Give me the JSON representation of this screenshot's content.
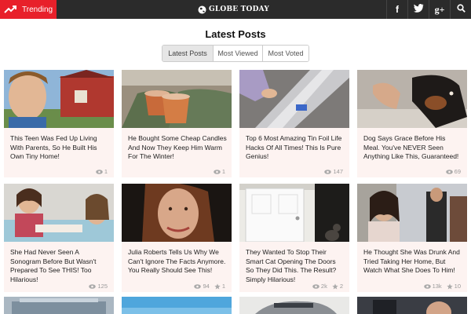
{
  "topbar": {
    "trending_label": "Trending",
    "brand": "GLOBE TODAY",
    "social": [
      {
        "name": "facebook",
        "glyph": "f"
      },
      {
        "name": "twitter",
        "glyph": ""
      },
      {
        "name": "google-plus",
        "glyph": "g+"
      },
      {
        "name": "search",
        "glyph": ""
      }
    ]
  },
  "main": {
    "title": "Latest Posts",
    "tabs": [
      {
        "label": "Latest Posts",
        "active": true
      },
      {
        "label": "Most Viewed",
        "active": false
      },
      {
        "label": "Most Voted",
        "active": false
      }
    ]
  },
  "posts": [
    {
      "title": "This Teen Was Fed Up Living With Parents, So He Built His Own Tiny Home!",
      "views": "1",
      "votes": ""
    },
    {
      "title": "He Bought Some Cheap Candles And Now They Keep Him Warm For The Winter!",
      "views": "1",
      "votes": ""
    },
    {
      "title": "Top 6 Most Amazing Tin Foil Life Hacks Of All Times! This Is Pure Genius!",
      "views": "147",
      "votes": ""
    },
    {
      "title": "Dog Says Grace Before His Meal. You've NEVER Seen Anything Like This, Guaranteed!",
      "views": "69",
      "votes": ""
    },
    {
      "title": "She Had Never Seen A Sonogram Before But Wasn't Prepared To See THIS! Too Hilarious!",
      "views": "125",
      "votes": ""
    },
    {
      "title": "Julia Roberts Tells Us Why We Can't Ignore The Facts Anymore. You Really Should See This!",
      "views": "94",
      "votes": "1"
    },
    {
      "title": "They Wanted To Stop Their Smart Cat Opening The Doors So They Did This. The Result? Simply Hilarious!",
      "views": "2k",
      "votes": "2"
    },
    {
      "title": "He Thought She Was Drunk And Tried Taking Her Home, But Watch What She Does To Him!",
      "views": "13k",
      "votes": "10"
    }
  ],
  "colors": {
    "topbar": "#2b2b2b",
    "accent": "#e8202a",
    "card_bg": "#fdf3f1"
  }
}
